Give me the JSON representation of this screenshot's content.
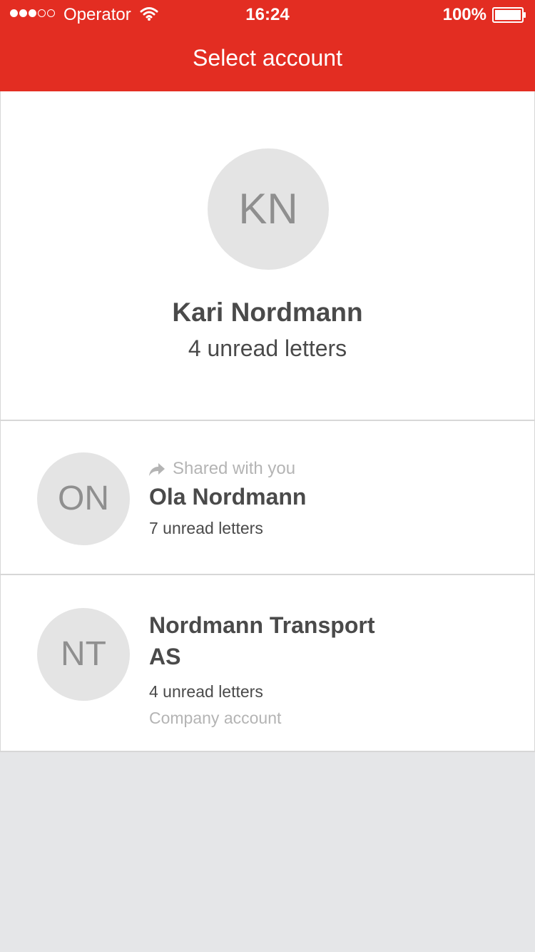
{
  "status_bar": {
    "carrier": "Operator",
    "time": "16:24",
    "battery": "100%"
  },
  "header": {
    "title": "Select account"
  },
  "accounts": [
    {
      "initials": "KN",
      "name": "Kari Nordmann",
      "unread": "4 unread letters"
    },
    {
      "initials": "ON",
      "shared_label": "Shared with you",
      "name": "Ola Nordmann",
      "unread": "7 unread letters"
    },
    {
      "initials": "NT",
      "name": "Nordmann Transport AS",
      "unread": "4 unread letters",
      "type": "Company account"
    }
  ],
  "colors": {
    "brand": "#e32d22",
    "background": "#e5e6e8",
    "avatar": "#e4e4e4",
    "text": "#4a4a4a",
    "muted": "#b4b4b4"
  },
  "icons": {
    "signal": "signal-dots-icon",
    "wifi": "wifi-icon",
    "battery": "battery-icon",
    "shared": "share-arrow-icon"
  }
}
